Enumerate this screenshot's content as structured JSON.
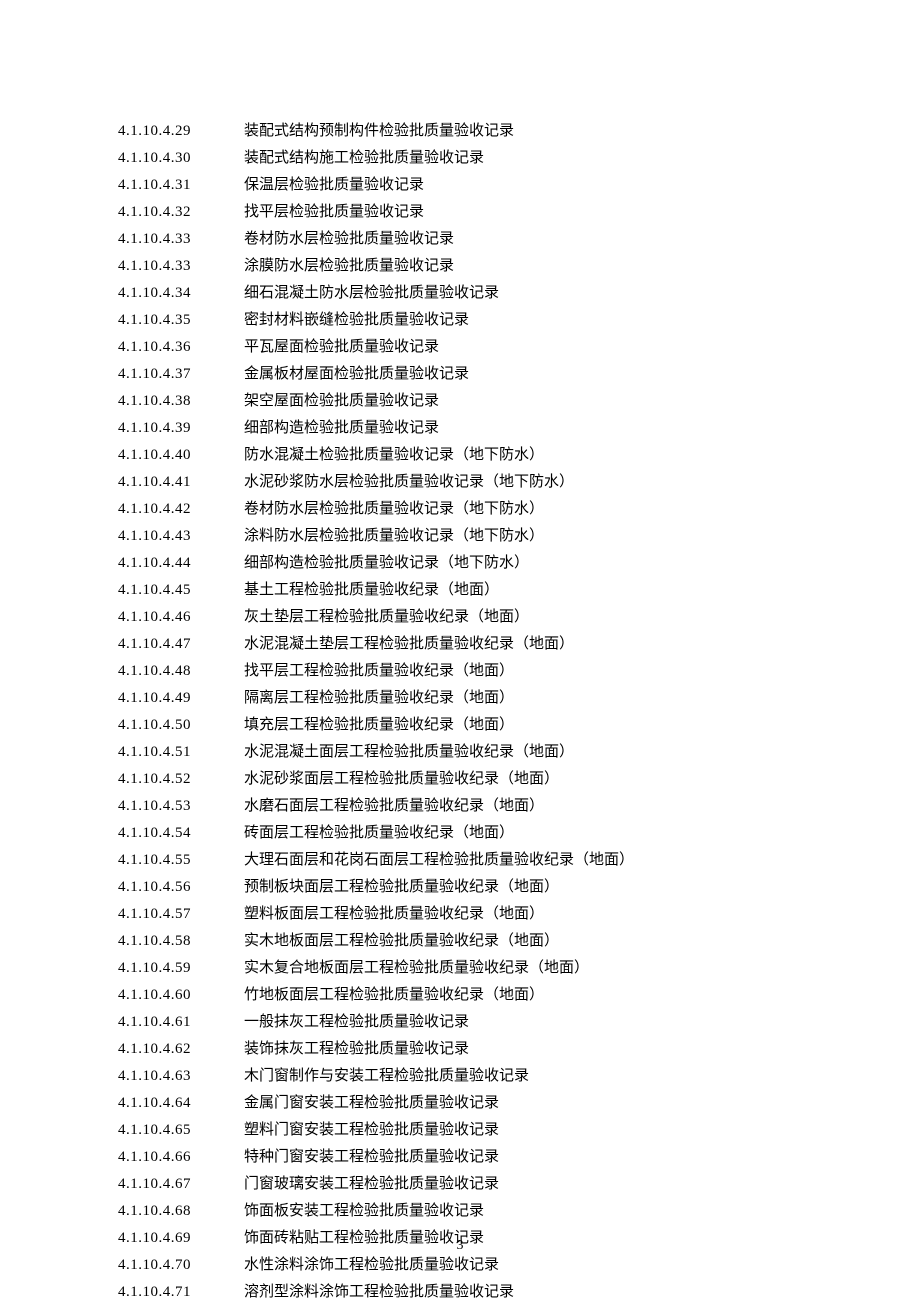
{
  "entries": [
    {
      "num": "4.1.10.4.29",
      "title": "装配式结构预制构件检验批质量验收记录"
    },
    {
      "num": "4.1.10.4.30",
      "title": "装配式结构施工检验批质量验收记录"
    },
    {
      "num": "4.1.10.4.31",
      "title": "保温层检验批质量验收记录"
    },
    {
      "num": "4.1.10.4.32",
      "title": "找平层检验批质量验收记录"
    },
    {
      "num": "4.1.10.4.33",
      "title": "卷材防水层检验批质量验收记录"
    },
    {
      "num": "4.1.10.4.33",
      "title": "涂膜防水层检验批质量验收记录"
    },
    {
      "num": "4.1.10.4.34",
      "title": "细石混凝土防水层检验批质量验收记录"
    },
    {
      "num": "4.1.10.4.35",
      "title": "密封材料嵌缝检验批质量验收记录"
    },
    {
      "num": "4.1.10.4.36",
      "title": "平瓦屋面检验批质量验收记录"
    },
    {
      "num": "4.1.10.4.37",
      "title": "金属板材屋面检验批质量验收记录"
    },
    {
      "num": "4.1.10.4.38",
      "title": "架空屋面检验批质量验收记录"
    },
    {
      "num": "4.1.10.4.39",
      "title": "细部构造检验批质量验收记录"
    },
    {
      "num": "4.1.10.4.40",
      "title": "防水混凝土检验批质量验收记录（地下防水）"
    },
    {
      "num": "4.1.10.4.41",
      "title": "水泥砂浆防水层检验批质量验收记录（地下防水）"
    },
    {
      "num": "4.1.10.4.42",
      "title": "卷材防水层检验批质量验收记录（地下防水）"
    },
    {
      "num": "4.1.10.4.43",
      "title": "涂料防水层检验批质量验收记录（地下防水）"
    },
    {
      "num": "4.1.10.4.44",
      "title": "细部构造检验批质量验收记录（地下防水）"
    },
    {
      "num": "4.1.10.4.45",
      "title": "基土工程检验批质量验收纪录（地面）"
    },
    {
      "num": "4.1.10.4.46",
      "title": "灰土垫层工程检验批质量验收纪录（地面）"
    },
    {
      "num": "4.1.10.4.47",
      "title": "水泥混凝土垫层工程检验批质量验收纪录（地面）"
    },
    {
      "num": "4.1.10.4.48",
      "title": "找平层工程检验批质量验收纪录（地面）"
    },
    {
      "num": "4.1.10.4.49",
      "title": "隔离层工程检验批质量验收纪录（地面）"
    },
    {
      "num": "4.1.10.4.50",
      "title": "填充层工程检验批质量验收纪录（地面）"
    },
    {
      "num": "4.1.10.4.51",
      "title": "水泥混凝土面层工程检验批质量验收纪录（地面）"
    },
    {
      "num": "4.1.10.4.52",
      "title": "水泥砂浆面层工程检验批质量验收纪录（地面）"
    },
    {
      "num": "4.1.10.4.53",
      "title": "水磨石面层工程检验批质量验收纪录（地面）"
    },
    {
      "num": "4.1.10.4.54",
      "title": "砖面层工程检验批质量验收纪录（地面）"
    },
    {
      "num": "4.1.10.4.55",
      "title": "大理石面层和花岗石面层工程检验批质量验收纪录（地面）"
    },
    {
      "num": "4.1.10.4.56",
      "title": "预制板块面层工程检验批质量验收纪录（地面）"
    },
    {
      "num": "4.1.10.4.57",
      "title": "塑料板面层工程检验批质量验收纪录（地面）"
    },
    {
      "num": "4.1.10.4.58",
      "title": "实木地板面层工程检验批质量验收纪录（地面）"
    },
    {
      "num": "4.1.10.4.59",
      "title": "实木复合地板面层工程检验批质量验收纪录（地面）"
    },
    {
      "num": "4.1.10.4.60",
      "title": "竹地板面层工程检验批质量验收纪录（地面）"
    },
    {
      "num": "4.1.10.4.61",
      "title": "一般抹灰工程检验批质量验收记录"
    },
    {
      "num": "4.1.10.4.62",
      "title": "装饰抹灰工程检验批质量验收记录"
    },
    {
      "num": "4.1.10.4.63",
      "title": "木门窗制作与安装工程检验批质量验收记录"
    },
    {
      "num": "4.1.10.4.64",
      "title": "金属门窗安装工程检验批质量验收记录"
    },
    {
      "num": "4.1.10.4.65",
      "title": "塑料门窗安装工程检验批质量验收记录"
    },
    {
      "num": "4.1.10.4.66",
      "title": "特种门窗安装工程检验批质量验收记录"
    },
    {
      "num": "4.1.10.4.67",
      "title": "门窗玻璃安装工程检验批质量验收记录"
    },
    {
      "num": "4.1.10.4.68",
      "title": "饰面板安装工程检验批质量验收记录"
    },
    {
      "num": "4.1.10.4.69",
      "title": "饰面砖粘贴工程检验批质量验收记录"
    },
    {
      "num": "4.1.10.4.70",
      "title": "水性涂料涂饰工程检验批质量验收记录"
    },
    {
      "num": "4.1.10.4.71",
      "title": "溶剂型涂料涂饰工程检验批质量验收记录"
    }
  ],
  "pageNumber": "3"
}
